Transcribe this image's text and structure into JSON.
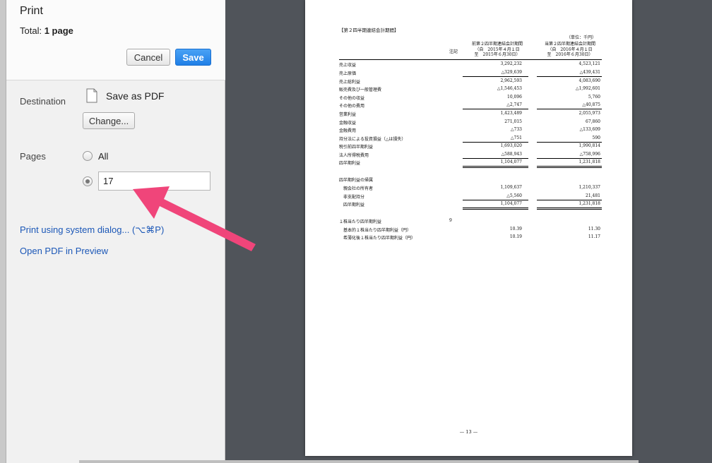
{
  "print": {
    "title": "Print",
    "total_prefix": "Total: ",
    "total_value": "1 page",
    "cancel_label": "Cancel",
    "save_label": "Save"
  },
  "destination": {
    "label": "Destination",
    "name": "Save as PDF",
    "change_label": "Change...",
    "icon": "document-icon"
  },
  "pages": {
    "label": "Pages",
    "all_label": "All",
    "selected": "custom",
    "custom_value": "17"
  },
  "links": {
    "system_dialog": "Print using system dialog... (⌥⌘P)",
    "open_preview": "Open PDF in Preview"
  },
  "annotation": {
    "color": "#f0457a",
    "icon": "pink-arrow"
  },
  "preview": {
    "header": "【第２四半期連結会計期間】",
    "unit": "（単位：千円）",
    "note_header": "注記",
    "col1_header": [
      "前第２四半期連結会計期間",
      "（自　2015年４月１日",
      "至　2015年６月30日）"
    ],
    "col2_header": [
      "当第２四半期連結会計期間",
      "（自　2016年４月１日",
      "至　2016年６月30日）"
    ],
    "rows": [
      {
        "label": "売上収益",
        "note": "",
        "v1": "3,292,232",
        "v2": "4,523,121"
      },
      {
        "label": "売上原価",
        "note": "",
        "v1": "△329,639",
        "v2": "△439,431"
      },
      {
        "label": "売上総利益",
        "note": "",
        "v1": "2,962,593",
        "v2": "4,083,690"
      },
      {
        "label": "販売費及び一般管理費",
        "note": "",
        "v1": "△1,546,453",
        "v2": "△1,992,601"
      },
      {
        "label": "その他の収益",
        "note": "",
        "v1": "10,096",
        "v2": "5,760"
      },
      {
        "label": "その他の費用",
        "note": "",
        "v1": "△2,747",
        "v2": "△40,875"
      },
      {
        "label": "営業利益",
        "note": "",
        "v1": "1,423,489",
        "v2": "2,055,973"
      },
      {
        "label": "金融収益",
        "note": "",
        "v1": "271,015",
        "v2": "67,860"
      },
      {
        "label": "金融費用",
        "note": "",
        "v1": "△733",
        "v2": "△133,609"
      },
      {
        "label": "持分法による投資損益（△は損失）",
        "note": "",
        "v1": "△751",
        "v2": "590"
      },
      {
        "label": "税引前四半期利益",
        "note": "",
        "v1": "1,693,020",
        "v2": "1,990,814"
      },
      {
        "label": "法人所得税費用",
        "note": "",
        "v1": "△588,943",
        "v2": "△758,996"
      },
      {
        "label": "四半期利益",
        "note": "",
        "v1": "1,104,077",
        "v2": "1,231,818"
      },
      {
        "label": "四半期利益の帰属",
        "note": "",
        "v1": "",
        "v2": ""
      },
      {
        "label": "　親会社の所有者",
        "note": "",
        "v1": "1,109,637",
        "v2": "1,210,337"
      },
      {
        "label": "　非支配持分",
        "note": "",
        "v1": "△5,560",
        "v2": "21,481"
      },
      {
        "label": "　四半期利益",
        "note": "",
        "v1": "1,104,077",
        "v2": "1,231,818"
      },
      {
        "label": "１株当たり四半期利益",
        "note": "9",
        "v1": "",
        "v2": ""
      },
      {
        "label": "　基本的１株当たり四半期利益（円）",
        "note": "",
        "v1": "10.39",
        "v2": "11.30"
      },
      {
        "label": "　希薄化後１株当たり四半期利益（円）",
        "note": "",
        "v1": "10.19",
        "v2": "11.17"
      }
    ],
    "page_number": "— 13 —"
  }
}
